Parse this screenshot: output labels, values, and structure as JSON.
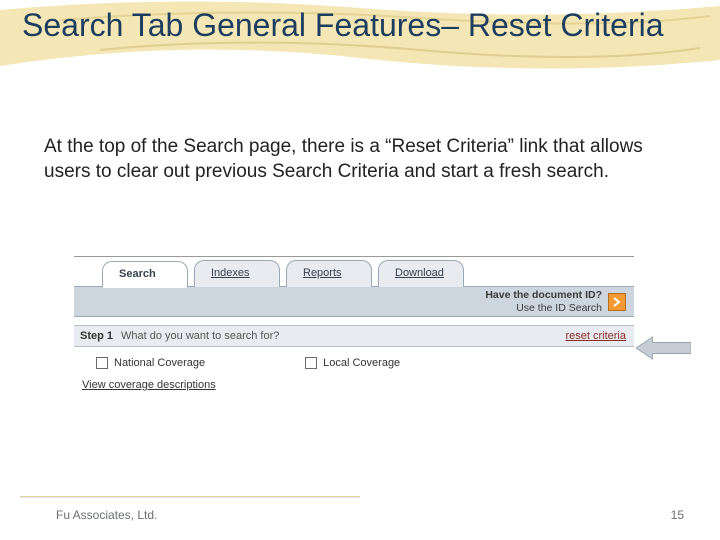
{
  "title": "Search Tab General Features– Reset Criteria",
  "body": "At the top of the Search page, there is a “Reset Criteria” link that allows users to clear out previous Search Criteria and start a fresh search.",
  "tabs": {
    "search": "Search",
    "indexes": "Indexes",
    "reports": "Reports",
    "download": "Download"
  },
  "subbar": {
    "line1": "Have the document ID?",
    "line2": "Use the ID Search"
  },
  "step": {
    "label": "Step 1",
    "question": "What do you want to search for?",
    "reset": "reset criteria"
  },
  "checks": {
    "national": "National Coverage",
    "local": "Local Coverage"
  },
  "view_link": "View coverage descriptions",
  "footer_left": "Fu Associates, Ltd.",
  "footer_right": "15"
}
